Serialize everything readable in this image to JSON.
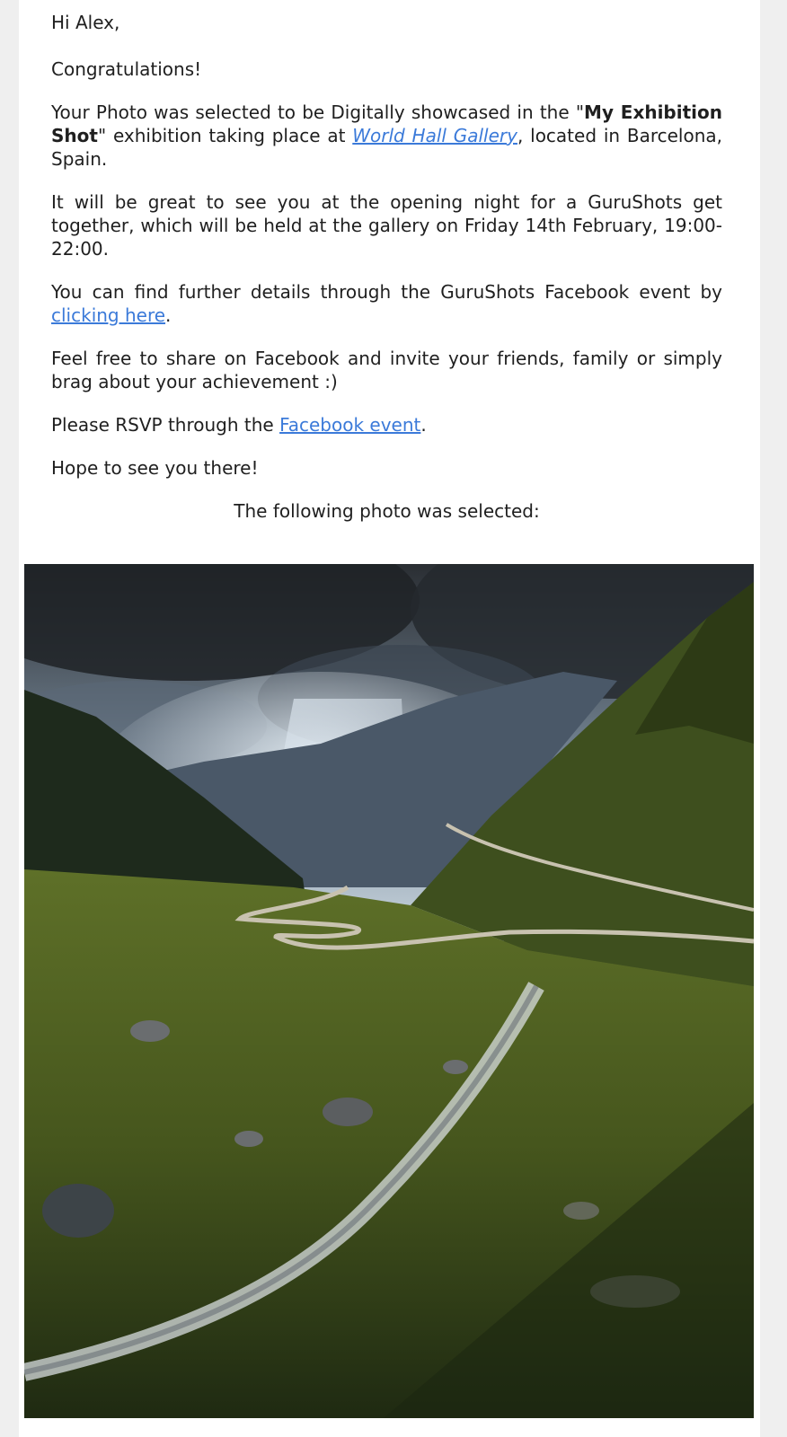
{
  "email": {
    "greeting": "Hi Alex,",
    "congrats": "Congratulations!",
    "selected_pre": "Your Photo was selected to be Digitally showcased in the \"",
    "exhibition_name": "My Exhibition Shot",
    "selected_mid": "\" exhibition taking place at ",
    "gallery_link": "World Hall Gallery",
    "selected_post": ", located in Barcelona, Spain.",
    "opening_night": "It will be great to see you at the opening night for a GuruShots get together, which will be held at the gallery on Friday 14th February, 19:00-22:00.",
    "details_pre": "You can find further details through the GuruShots Facebook event by ",
    "details_link": "clicking here",
    "details_post": ".",
    "share": "Feel free to share on Facebook and invite your friends, family or simply brag about your achievement :)",
    "rsvp_pre": "Please RSVP through the ",
    "rsvp_link": "Facebook event",
    "rsvp_post": ".",
    "hope": "Hope to see you there!",
    "photo_caption": "The following photo was selected:"
  },
  "photo": {
    "subject": "mountain valley with winding road and stream under stormy sky",
    "colors": {
      "sky_dark": "#2a2e33",
      "sky_light": "#c9d6e0",
      "mountain": "#3c4a58",
      "grass": "#4c5e22",
      "grass_dark": "#1f2a12",
      "road": "#c8c2b0",
      "stream": "#d8dde0"
    }
  },
  "colors": {
    "link": "#3b7ad9",
    "page_bg": "#efefef",
    "card_bg": "#ffffff",
    "text": "#1f1f1f"
  }
}
